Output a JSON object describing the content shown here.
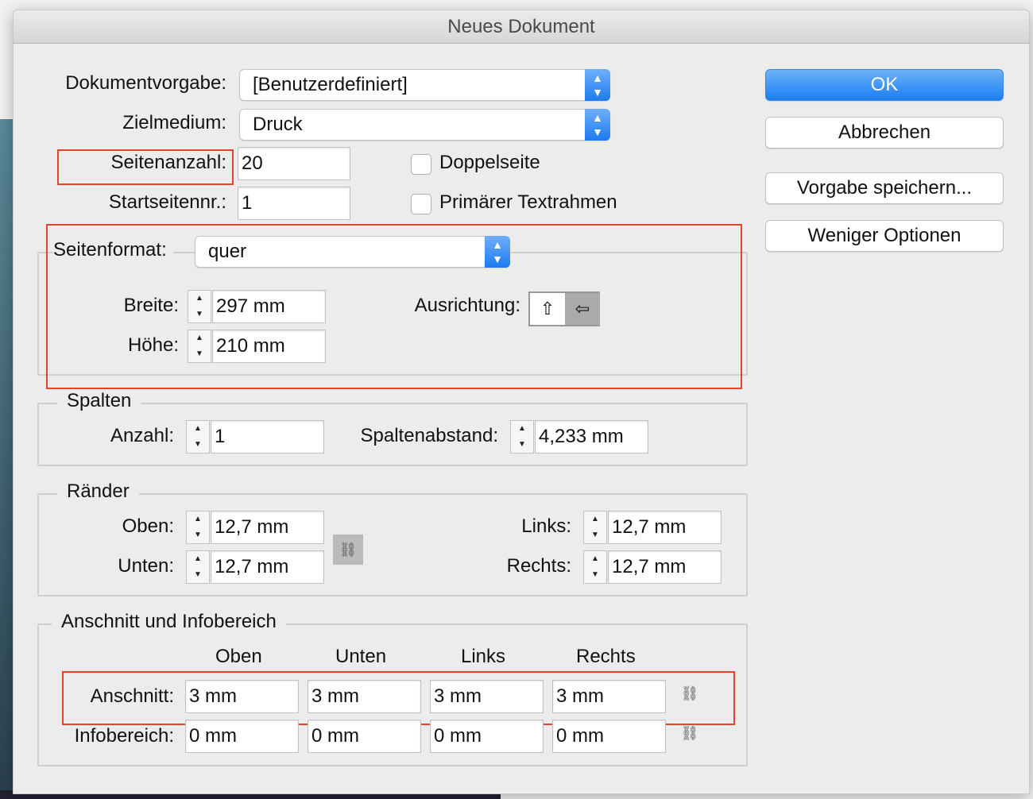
{
  "window": {
    "title": "Neues Dokument"
  },
  "top": {
    "preset_label": "Dokumentvorgabe:",
    "preset_value": "[Benutzerdefiniert]",
    "intent_label": "Zielmedium:",
    "intent_value": "Druck",
    "pages_label": "Seitenanzahl:",
    "pages_value": "20",
    "start_label": "Startseitennr.:",
    "start_value": "1",
    "facing_label": "Doppelseite",
    "facing_checked": false,
    "primary_frame_label": "Primärer Textrahmen",
    "primary_frame_checked": false
  },
  "page_size": {
    "label": "Seitenformat:",
    "value": "quer",
    "width_label": "Breite:",
    "width_value": "297 mm",
    "height_label": "Höhe:",
    "height_value": "210 mm",
    "orientation_label": "Ausrichtung:",
    "orientation_selected": "landscape"
  },
  "columns": {
    "title": "Spalten",
    "count_label": "Anzahl:",
    "count_value": "1",
    "gutter_label": "Spaltenabstand:",
    "gutter_value": "4,233 mm"
  },
  "margins": {
    "title": "Ränder",
    "top_label": "Oben:",
    "top_value": "12,7 mm",
    "bottom_label": "Unten:",
    "bottom_value": "12,7 mm",
    "left_label": "Links:",
    "left_value": "12,7 mm",
    "right_label": "Rechts:",
    "right_value": "12,7 mm"
  },
  "bleed": {
    "title": "Anschnitt und Infobereich",
    "headers": [
      "Oben",
      "Unten",
      "Links",
      "Rechts"
    ],
    "bleed_label": "Anschnitt:",
    "bleed_values": [
      "3 mm",
      "3 mm",
      "3 mm",
      "3 mm"
    ],
    "slug_label": "Infobereich:",
    "slug_values": [
      "0 mm",
      "0 mm",
      "0 mm",
      "0 mm"
    ]
  },
  "buttons": {
    "ok": "OK",
    "cancel": "Abbrechen",
    "save_preset": "Vorgabe speichern...",
    "fewer_options": "Weniger Optionen"
  },
  "colors": {
    "accent": "#1d7bf0",
    "highlight": "#e2452c"
  }
}
